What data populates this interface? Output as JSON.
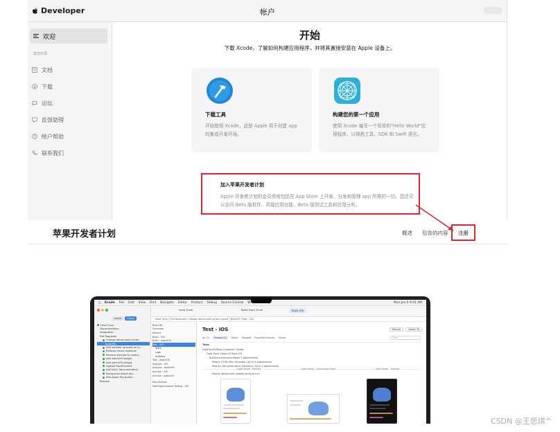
{
  "screenshot1": {
    "brand": "Developer",
    "title": "帐户",
    "sidebar": {
      "welcome": "欢迎",
      "section_label": "其他资源",
      "items": [
        {
          "label": "文档",
          "icon": "doc-icon"
        },
        {
          "label": "下载",
          "icon": "download-icon"
        },
        {
          "label": "论坛",
          "icon": "forum-icon"
        },
        {
          "label": "反馈助理",
          "icon": "feedback-icon"
        },
        {
          "label": "帐户帮助",
          "icon": "help-icon"
        },
        {
          "label": "联系我们",
          "icon": "phone-icon"
        }
      ]
    },
    "main": {
      "title": "开始",
      "subtitle": "下载 Xcode，了解如何构建应用程序，并将其置接安装在 Apple 设备上。",
      "cards": [
        {
          "title": "下载工具",
          "desc": "开始使用 Xcode，这是 Apple 用于创建 app 的集成开发环境。",
          "icon": "xcode-hammer-icon",
          "accent": "#1e88d6"
        },
        {
          "title": "构建您的第一个应用",
          "desc": "使用 Xcode 编写一个简单的\"Hello World\"应用程序，以熟悉工具、SDK 和 Swift 语言。",
          "icon": "app-grid-icon",
          "accent": "#2db0d8"
        }
      ],
      "join": {
        "title": "加入苹果开发者计划",
        "desc": "Apple 开发者计划的会员资格包括在 App Store 上开发、分发和管理 app 所需的一切。您还可以访问 Beta 版软件、高级应用功能、Beta 版测试工具和应用分析。"
      }
    }
  },
  "program_header": {
    "title": "苹果开发者计划",
    "nav": [
      "概述",
      "包含的内容",
      "注册"
    ]
  },
  "xcode": {
    "menubar": [
      "Xcode",
      "File",
      "Edit",
      "View",
      "Find",
      "Navigate",
      "Editor",
      "Product",
      "Debug",
      "Source Control",
      "Window",
      "Help"
    ],
    "menubar_right": "Mon Jun 6  9:41 AM",
    "tabs": [
      "Food Truck",
      "Build Food Truck",
      "Build iOS"
    ],
    "filter": [
      "Local",
      "Cloud"
    ],
    "breadcrumb": "Food Truck  |  Pull Requests  |  Change donut order screen layout  |  Build 87  |  Test - iOS",
    "navigator": [
      "Food Truck",
      "Documentation",
      "Integration",
      "Pull Requests",
      "Change donut order scree...",
      "Build 88",
      "Add weather forecast on ty...",
      "Refactor donut organizer",
      "Remove bitcode for watch...",
      "Add watchOS widget",
      "Add watchOS widget",
      "Update FoodTruckKit",
      "Add DocC documentation",
      "Reorganize donut tab...",
      "Add Apple Pay button",
      "Release"
    ],
    "mid_list": [
      "Build 88",
      "Overview",
      "Actions",
      "Build - iOS",
      "Build - watchOS",
      "Test - iOS",
      "Tests",
      "Logs",
      "Artifacts",
      "Test - watchOS",
      "Analyze - iOS",
      "Analyze - watchOS",
      "Archive - iOS",
      "Archive - watchOS",
      "Post Actions",
      "TestFlight Internal Testing - iOS"
    ],
    "editor": {
      "title": "Test - iOS",
      "buttons": [
        "Rebuild",
        "Switch To"
      ],
      "tabs": [
        "All (4)",
        "Passed (3)",
        "Failed",
        "Skipped",
        "Expected Failures",
        "Mixed"
      ],
      "search_placeholder": "Filter",
      "section": "Tests",
      "rows": [
        "FoodTruckUITests  2 passed  0 failed",
        "Food Truck Cases  All Tests  iOS",
        "BuildLaunchScreenUITests  2 attachments",
        "iPhone 13 Pro Max Simulator (16.0)  4 attachments",
        "iPad Air (5th generation) Simulator (16.0)  4 attachments",
        "Robust attachment named donut launch"
      ],
      "columns": [
        "Light Mode - Portrait",
        "Light Mode - Landscape Right",
        "Dark Mode - Portrait"
      ]
    }
  },
  "watermark": "CSDN @王思琪^"
}
